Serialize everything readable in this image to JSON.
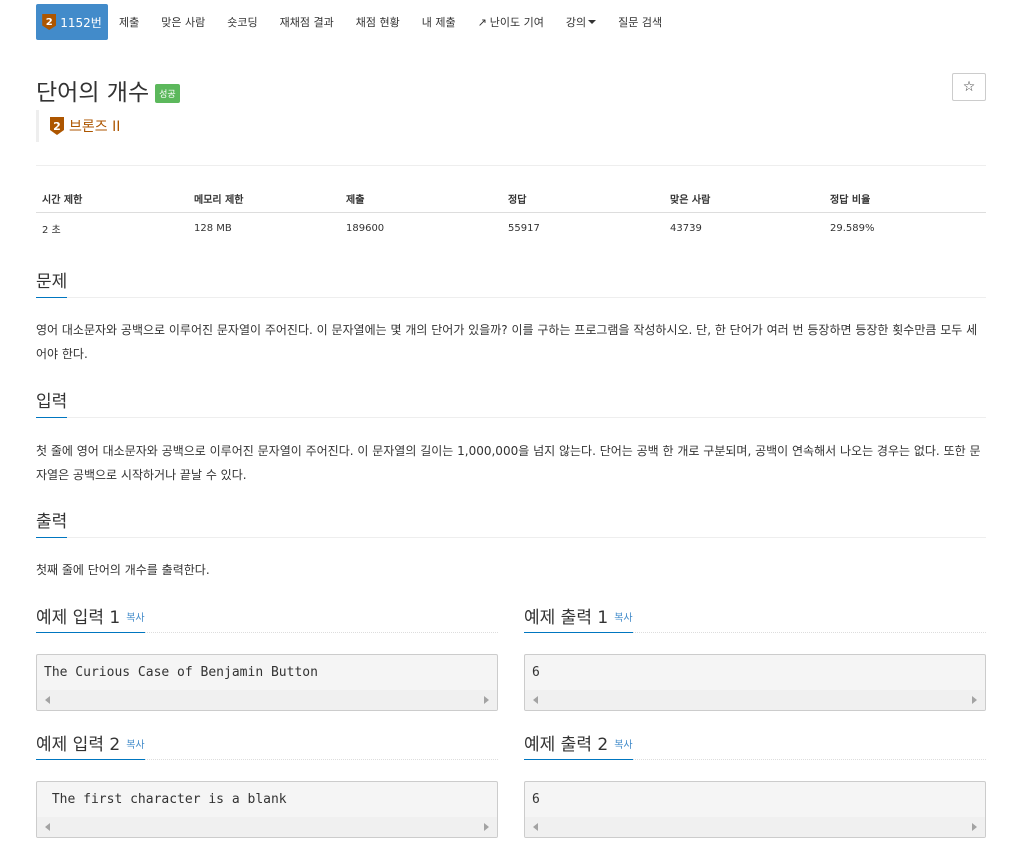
{
  "nav": {
    "problem_badge": "2",
    "problem_id": "1152번",
    "items": [
      "제출",
      "맞은 사람",
      "숏코딩",
      "재채점 결과",
      "채점 현황",
      "내 제출"
    ],
    "contribute": "난이도 기여",
    "lecture": "강의",
    "qna": "질문 검색"
  },
  "header": {
    "title": "단어의 개수",
    "status": "성공",
    "star": "☆",
    "tier_badge": "2",
    "tier": "브론즈 II",
    "tier_color": "#ad5600"
  },
  "info": {
    "headers": [
      "시간 제한",
      "메모리 제한",
      "제출",
      "정답",
      "맞은 사람",
      "정답 비율"
    ],
    "values": [
      "2 초",
      "128 MB",
      "189600",
      "55917",
      "43739",
      "29.589%"
    ]
  },
  "sections": {
    "problem": {
      "title": "문제",
      "text": "영어 대소문자와 공백으로 이루어진 문자열이 주어진다. 이 문자열에는 몇 개의 단어가 있을까? 이를 구하는 프로그램을 작성하시오. 단, 한 단어가 여러 번 등장하면 등장한 횟수만큼 모두 세어야 한다."
    },
    "input": {
      "title": "입력",
      "text": "첫 줄에 영어 대소문자와 공백으로 이루어진 문자열이 주어진다. 이 문자열의 길이는 1,000,000을 넘지 않는다. 단어는 공백 한 개로 구분되며, 공백이 연속해서 나오는 경우는 없다. 또한 문자열은 공백으로 시작하거나 끝날 수 있다."
    },
    "output": {
      "title": "출력",
      "text": "첫째 줄에 단어의 개수를 출력한다."
    }
  },
  "samples": {
    "copy_label": "복사",
    "in1_title": "예제 입력 1",
    "in1": "The Curious Case of Benjamin Button",
    "out1_title": "예제 출력 1",
    "out1": "6",
    "in2_title": "예제 입력 2",
    "in2": " The first character is a blank",
    "out2_title": "예제 출력 2",
    "out2": "6"
  },
  "colors": {
    "primary": "#428bca",
    "success": "#5cb85c",
    "accent_line": "#0076c0"
  }
}
